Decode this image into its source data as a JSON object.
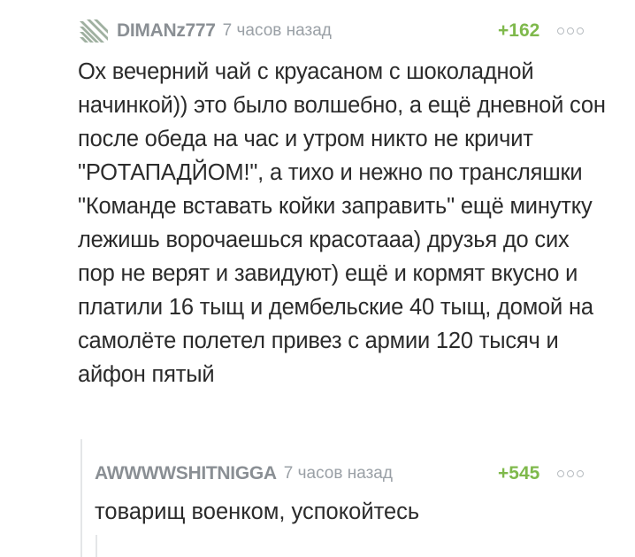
{
  "comments": [
    {
      "username": "DIMANz777",
      "time": "7 часов назад",
      "score": "+162",
      "text": "Ох вечерний чай с круасаном с шоколадной начинкой)) это было волшебно, а ещё дневной сон после обеда на час и утром никто не кричит \"РОТАПАДЙОМ!\", а тихо и нежно по трансляшки \"Команде вставать койки заправить\" ещё минутку лежишь ворочаешься красотааа) друзья до сих пор не верят и завидуют) ещё и кормят вкусно и платили 16 тыщ и дембельские 40 тыщ, домой на самолёте полетел привез с армии 120 тысяч и айфон пятый",
      "avatar_icon": "diagonal-stripes-icon"
    },
    {
      "username": "AWWWWSHITNIGGA",
      "time": "7 часов назад",
      "score": "+545",
      "text": "товарищ военком, успокойтесь"
    }
  ],
  "colors": {
    "username": "#8a8f94",
    "score": "#7fb94c",
    "text": "#2b2b2b",
    "thread_line": "#e4e6e8"
  }
}
